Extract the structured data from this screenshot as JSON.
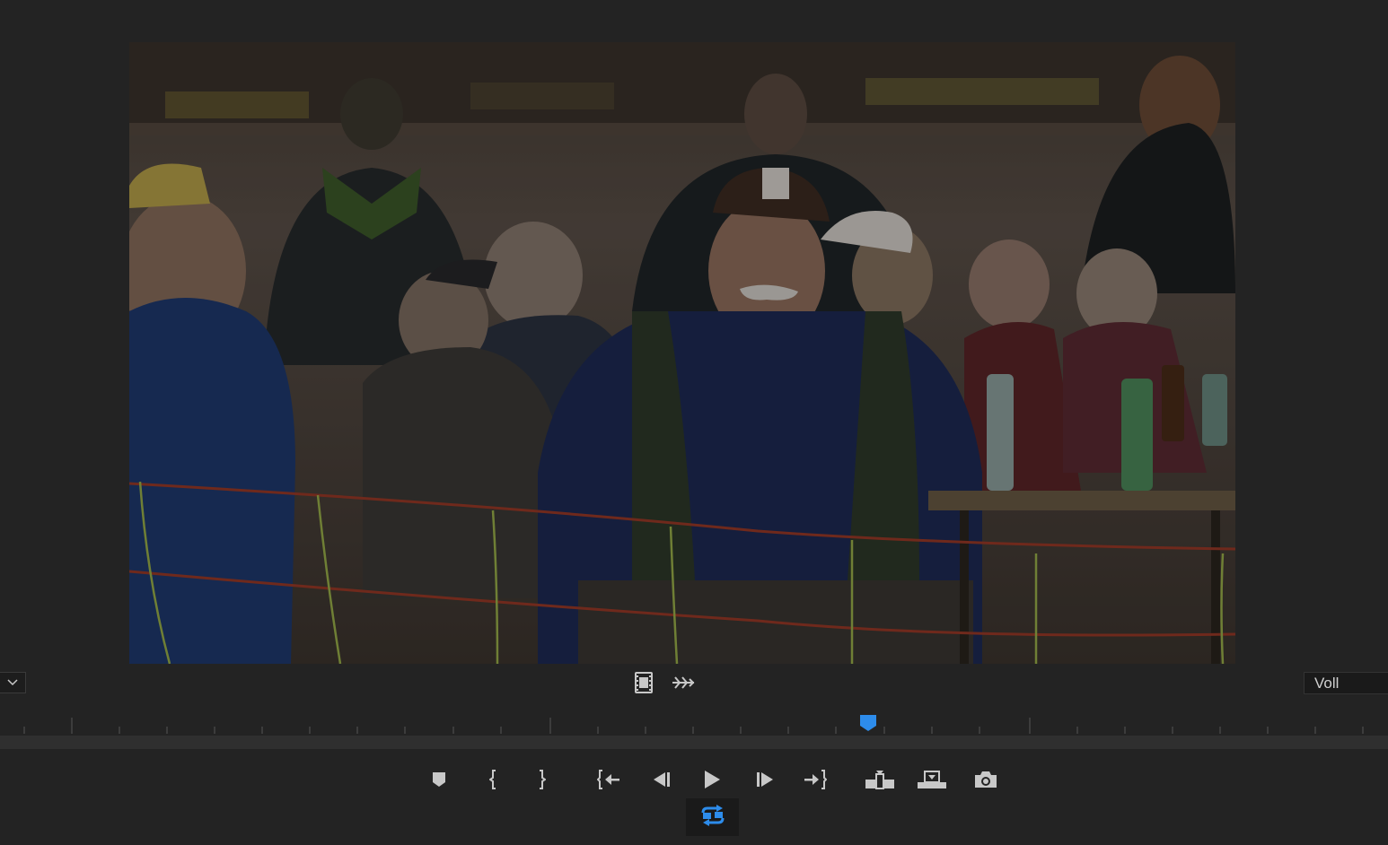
{
  "resolution": {
    "selected": "Voll"
  },
  "icons": {
    "frame_settings": "film-frame-icon",
    "audio_scrub": "audio-waveform-icon",
    "marker": "marker-icon",
    "mark_in": "mark-in-icon",
    "mark_out": "mark-out-icon",
    "go_to_in": "go-to-in-icon",
    "step_back": "step-back-icon",
    "play": "play-icon",
    "step_forward": "step-forward-icon",
    "go_to_out": "go-to-out-icon",
    "insert": "insert-icon",
    "overwrite": "overwrite-icon",
    "export_frame": "camera-icon",
    "loop": "loop-icon",
    "dropdown": "chevron-down-icon"
  },
  "colors": {
    "accent": "#2d8ceb",
    "background": "#232323",
    "icon": "#c8c8c8"
  }
}
